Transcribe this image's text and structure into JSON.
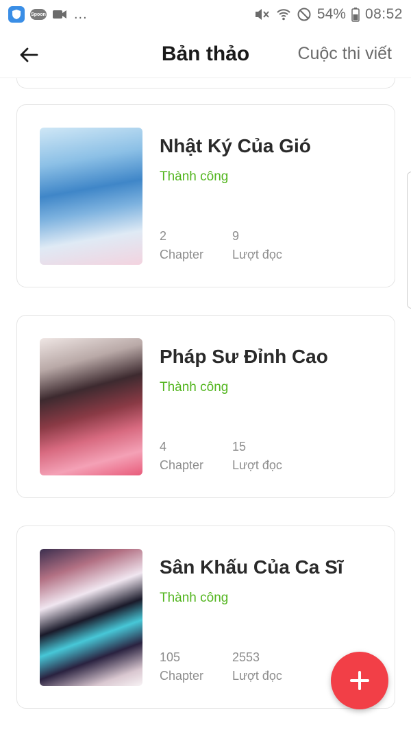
{
  "status_bar": {
    "notification_icons": [
      "shield-icon",
      "spoon-app-icon",
      "video-camera-icon"
    ],
    "spoon_label": "Spoon",
    "overflow": "...",
    "battery_percent": "54%",
    "time": "08:52"
  },
  "header": {
    "title": "Bản thảo",
    "right_link": "Cuộc thi viết"
  },
  "stories": [
    {
      "title": "Nhật Ký Của Gió",
      "status": "Thành công",
      "chapters": "2",
      "chapter_label": "Chapter",
      "reads": "9",
      "reads_label": "Lượt đọc"
    },
    {
      "title": "Pháp Sư Đỉnh Cao",
      "status": "Thành công",
      "chapters": "4",
      "chapter_label": "Chapter",
      "reads": "15",
      "reads_label": "Lượt đọc"
    },
    {
      "title": "Sân Khấu Của Ca Sĩ",
      "status": "Thành công",
      "chapters": "105",
      "chapter_label": "Chapter",
      "reads": "2553",
      "reads_label": "Lượt đọc"
    }
  ],
  "colors": {
    "status_success": "#52b51e",
    "fab": "#f23f47",
    "title": "#1a1a1a",
    "muted": "#8d8d8d"
  },
  "fab": {
    "icon": "plus-icon"
  }
}
